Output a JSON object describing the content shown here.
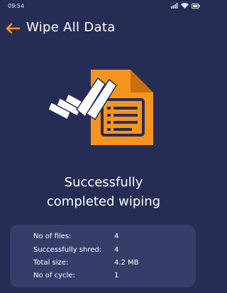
{
  "status_bar": {
    "time": "09:54",
    "icons": [
      "signal-icon",
      "wifi-icon",
      "battery-icon"
    ]
  },
  "header": {
    "back_icon": "arrow-left-icon",
    "title": "Wipe All Data"
  },
  "illustration": {
    "name": "document-checkmark-illustration",
    "document_color": "#f7941d",
    "check_color": "#ffffff"
  },
  "result": {
    "line1": "Successfully",
    "line2": "completed wiping"
  },
  "summary": [
    {
      "label": "No of files:",
      "value": "4"
    },
    {
      "label": "Successfully shred:",
      "value": "4"
    },
    {
      "label": "Total size:",
      "value": "4.2 MB"
    },
    {
      "label": "No of cycle:",
      "value": "1"
    }
  ],
  "colors": {
    "background": "#262d55",
    "card": "#353d6b",
    "accent": "#f7941d"
  }
}
